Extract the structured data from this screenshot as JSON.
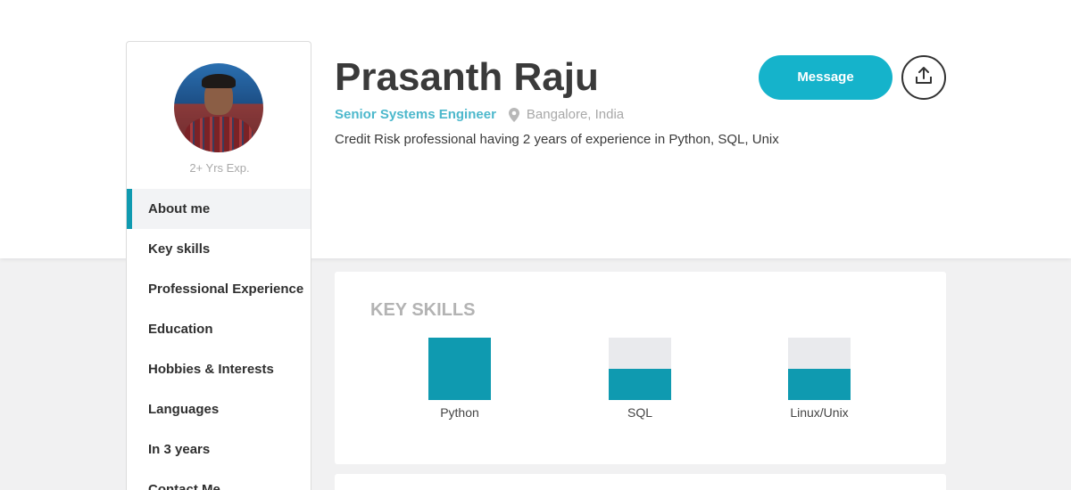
{
  "profile": {
    "name": "Prasanth Raju",
    "job_title": "Senior Systems Engineer",
    "location": "Bangalore, India",
    "summary": "Credit Risk professional having 2 years of experience in Python, SQL, Unix",
    "experience": "2+ Yrs Exp."
  },
  "actions": {
    "message_label": "Message",
    "share_icon": "share-upload-icon"
  },
  "sidebar": {
    "active_index": 0,
    "items": [
      {
        "label": "About me"
      },
      {
        "label": "Key skills"
      },
      {
        "label": "Professional Experience"
      },
      {
        "label": "Education"
      },
      {
        "label": "Hobbies & Interests"
      },
      {
        "label": "Languages"
      },
      {
        "label": "In 3 years"
      },
      {
        "label": "Contact Me"
      }
    ]
  },
  "skills": {
    "title": "KEY SKILLS",
    "items": [
      {
        "name": "Python",
        "level": 1.0
      },
      {
        "name": "SQL",
        "level": 0.5
      },
      {
        "name": "Linux/Unix",
        "level": 0.5
      }
    ]
  },
  "colors": {
    "accent": "#15b3cb",
    "bar": "#0f9ab0",
    "job_title": "#4cb8cc"
  }
}
